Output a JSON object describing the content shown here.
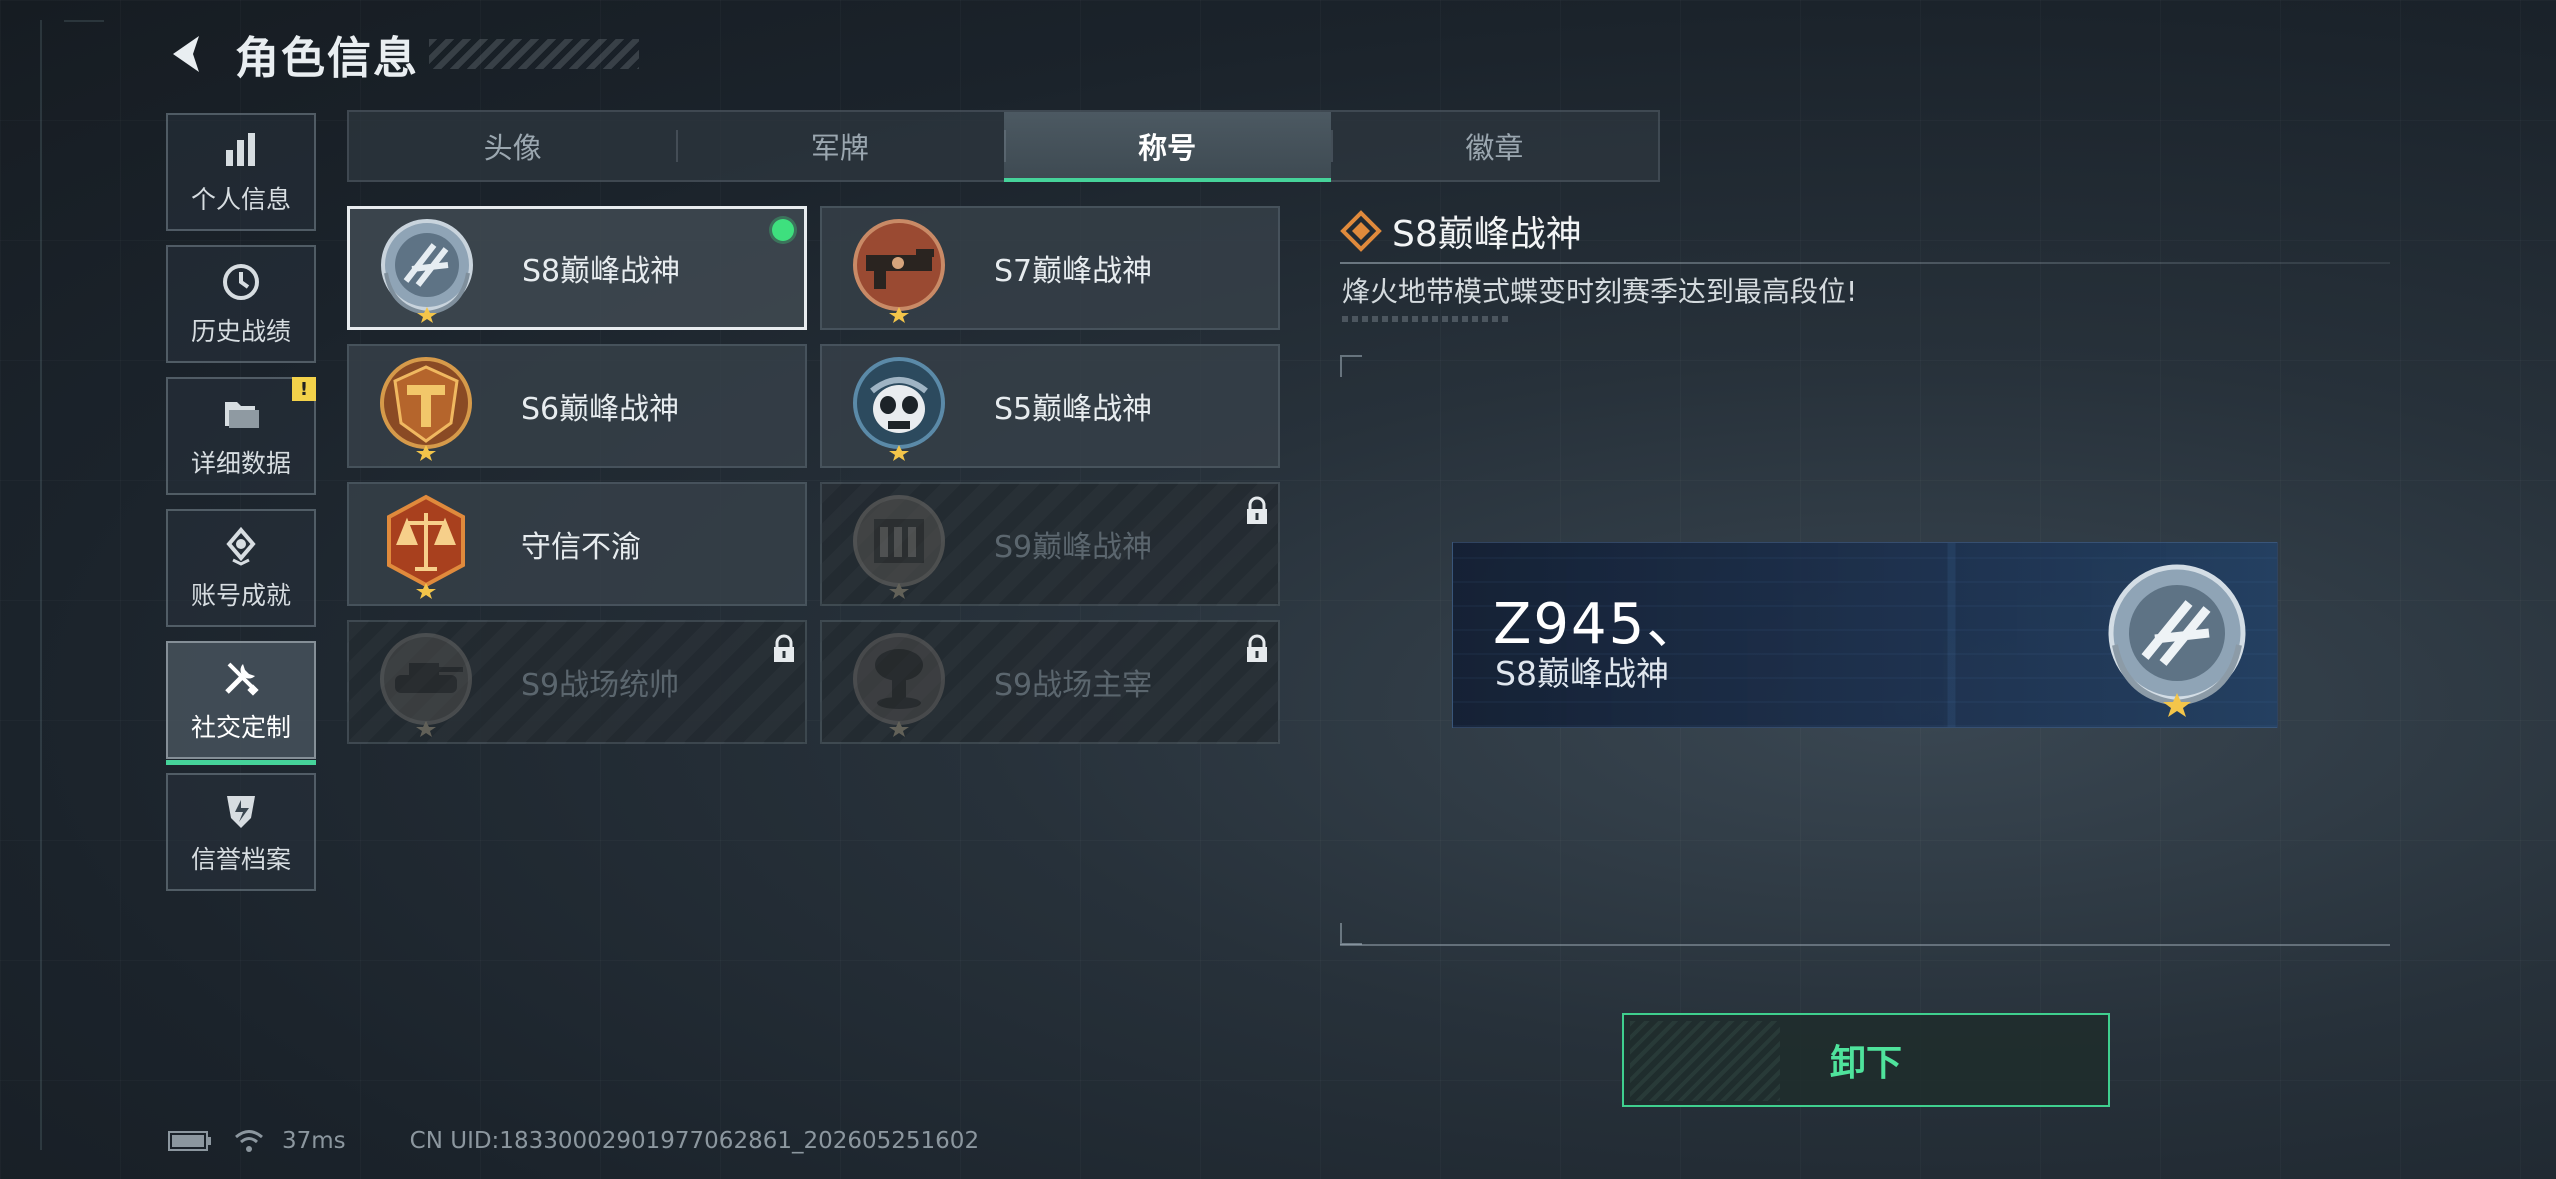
{
  "header": {
    "title": "角色信息"
  },
  "sidebar": {
    "items": [
      {
        "label": "个人信息",
        "icon": "bar-chart-icon",
        "active": false
      },
      {
        "label": "历史战绩",
        "icon": "clock-icon",
        "active": false
      },
      {
        "label": "详细数据",
        "icon": "folder-icon",
        "active": false,
        "badge": "!"
      },
      {
        "label": "账号成就",
        "icon": "achievement-icon",
        "active": false
      },
      {
        "label": "社交定制",
        "icon": "tools-icon",
        "active": true
      },
      {
        "label": "信誉档案",
        "icon": "shield-icon",
        "active": false
      }
    ]
  },
  "tabs": [
    {
      "label": "头像",
      "active": false
    },
    {
      "label": "军牌",
      "active": false
    },
    {
      "label": "称号",
      "active": true
    },
    {
      "label": "徽章",
      "active": false
    }
  ],
  "cards": [
    {
      "label": "S8巅峰战神",
      "emblem": "s8-emblem-icon",
      "selected": true,
      "equipped": true,
      "locked": false
    },
    {
      "label": "S7巅峰战神",
      "emblem": "s7-emblem-icon",
      "selected": false,
      "equipped": false,
      "locked": false
    },
    {
      "label": "S6巅峰战神",
      "emblem": "s6-emblem-icon",
      "selected": false,
      "equipped": false,
      "locked": false
    },
    {
      "label": "S5巅峰战神",
      "emblem": "s5-emblem-icon",
      "selected": false,
      "equipped": false,
      "locked": false
    },
    {
      "label": "守信不渝",
      "emblem": "scales-emblem-icon",
      "selected": false,
      "equipped": false,
      "locked": false
    },
    {
      "label": "S9巅峰战神",
      "emblem": "s9-emblem-icon",
      "selected": false,
      "equipped": false,
      "locked": true
    },
    {
      "label": "S9战场统帅",
      "emblem": "tank-emblem-icon",
      "selected": false,
      "equipped": false,
      "locked": true
    },
    {
      "label": "S9战场主宰",
      "emblem": "mushroom-cloud-emblem-icon",
      "selected": false,
      "equipped": false,
      "locked": true
    }
  ],
  "detail": {
    "title": "S8巅峰战神",
    "description": "烽火地带模式蝶变时刻赛季达到最高段位!",
    "preview": {
      "player_name": "Z945、",
      "title": "S8巅峰战神"
    },
    "action_label": "卸下"
  },
  "status": {
    "ping": "37ms",
    "uid": "CN UID:1833000290197706286​1_202605251602"
  },
  "colors": {
    "accent": "#46d39a",
    "equipped": "#3ee07e",
    "warning": "#f3d24a"
  }
}
